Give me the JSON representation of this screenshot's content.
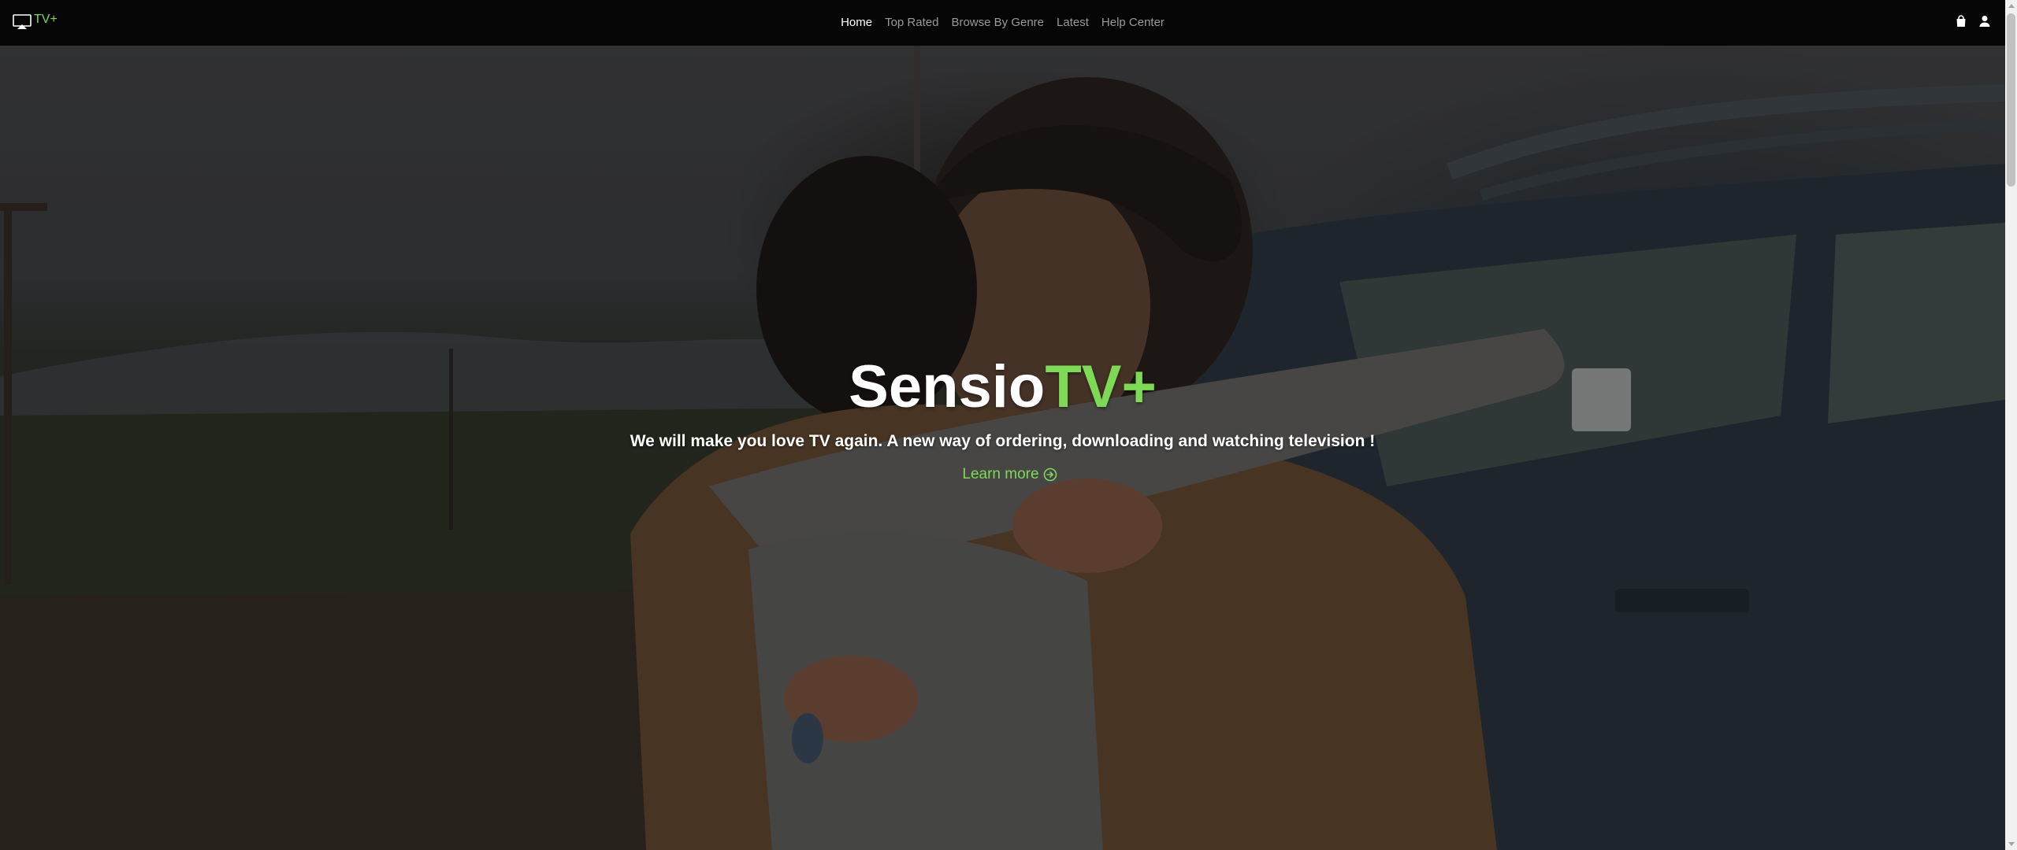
{
  "navbar": {
    "brand_label": "TV+",
    "links": [
      {
        "label": "Home",
        "active": true
      },
      {
        "label": "Top Rated",
        "active": false
      },
      {
        "label": "Browse By Genre",
        "active": false
      },
      {
        "label": "Latest",
        "active": false
      },
      {
        "label": "Help Center",
        "active": false
      }
    ],
    "icons": [
      "shopping-bag-icon",
      "user-icon"
    ]
  },
  "hero": {
    "title_main": "Sensio",
    "title_accent": "TV+",
    "subtitle": "We will make you love TV again. A new way of ordering, downloading and watching television !",
    "cta_label": "Learn more",
    "cta_icon": "arrow-circle-right-icon"
  },
  "colors": {
    "accent": "#7ed957",
    "navbar_bg": "#050505",
    "nav_link": "#9a9a9a",
    "nav_link_active": "#ffffff"
  }
}
